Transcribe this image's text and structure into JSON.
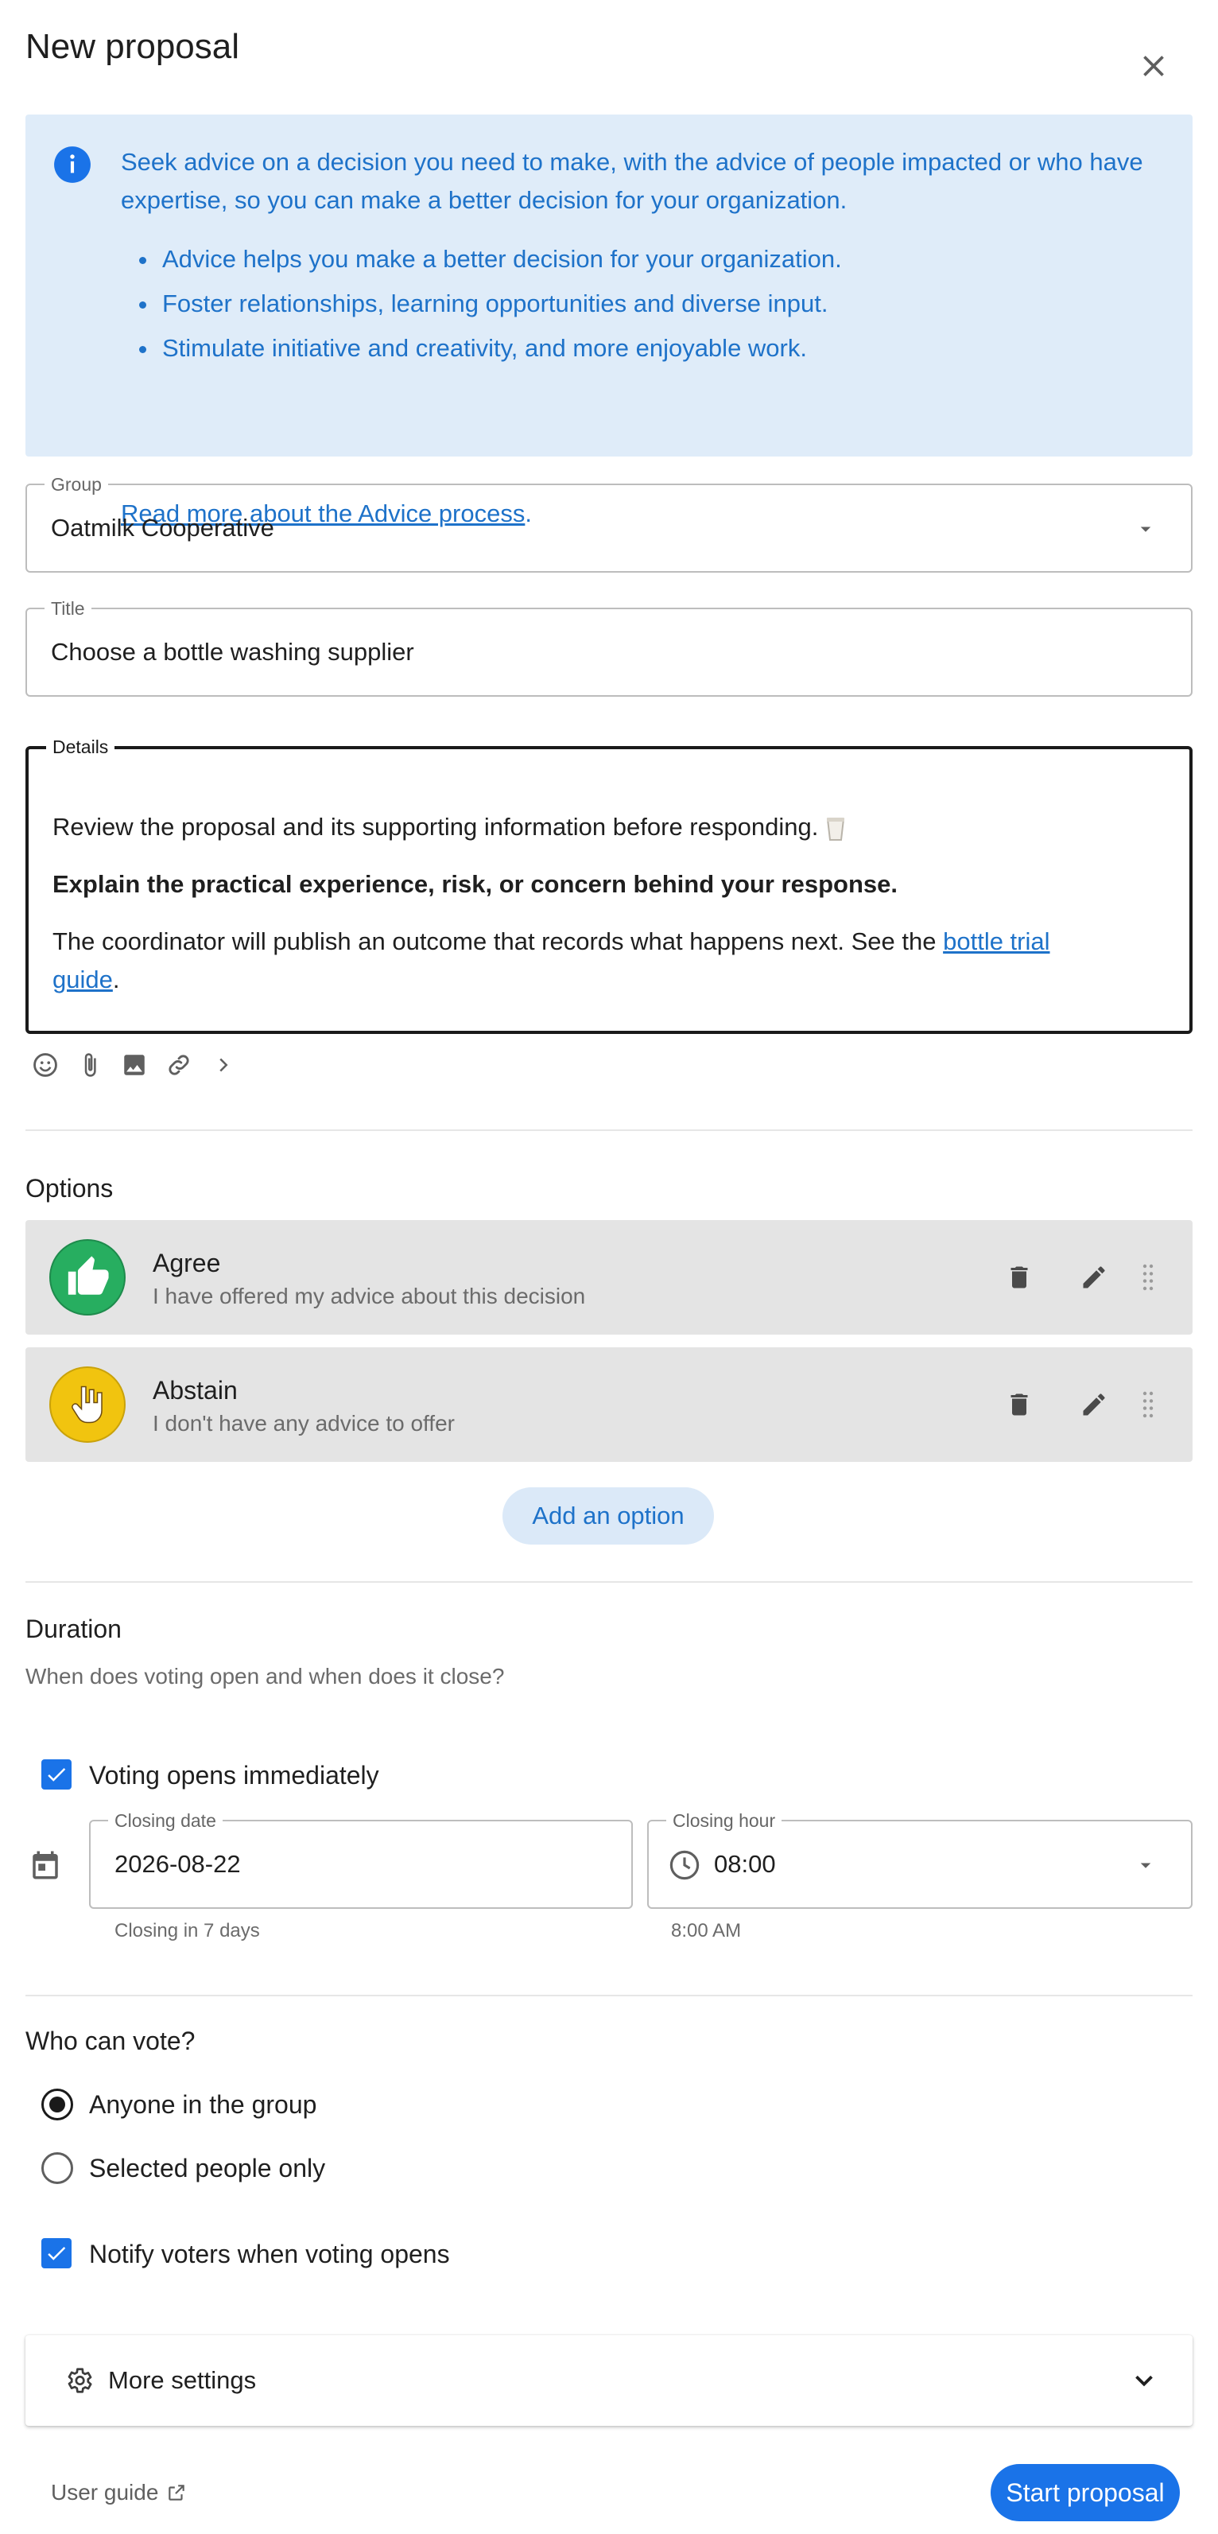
{
  "header": {
    "title": "New proposal",
    "close_icon": "close-icon"
  },
  "info_banner": {
    "icon": "info-icon",
    "intro": "Seek advice on a decision you need to make, with the advice of people impacted or who have expertise, so you can make a better decision for your organization.",
    "bullets": [
      "Advice helps you make a better decision for your organization.",
      "Foster relationships, learning opportunities and diverse input.",
      "Stimulate initiative and creativity, and more enjoyable work."
    ],
    "link_text": "Read more about the Advice process",
    "link_suffix": "."
  },
  "group": {
    "label": "Group",
    "value": "Oatmilk Cooperative"
  },
  "title_field": {
    "label": "Title",
    "value": "Choose a bottle washing supplier"
  },
  "details": {
    "label": "Details",
    "line1": "Review the proposal and its supporting information before responding.",
    "line1_icon": "cup-icon",
    "line2_bold": "Explain the practical experience, risk, or concern behind your response.",
    "line3_text": "The coordinator will publish an outcome that records what happens next. See the ",
    "line3_link_a": "bottle trial ",
    "line3_link_b": "guide",
    "line3_suffix": "."
  },
  "toolbar": {
    "icons": [
      "emoji-icon",
      "attachment-icon",
      "image-icon",
      "link-icon",
      "chevron-right-icon"
    ]
  },
  "options": {
    "title": "Options",
    "items": [
      {
        "title": "Agree",
        "description": "I have offered my advice about this decision",
        "color": "#27ae60",
        "icon": "thumbs-up-icon"
      },
      {
        "title": "Abstain",
        "description": "I don't have any advice to offer",
        "color": "#f1c40f",
        "icon": "hand-icon"
      }
    ],
    "add_label": "Add an option"
  },
  "duration": {
    "title": "Duration",
    "subtitle": "When does voting open and when does it close?",
    "opens_immediately_label": "Voting opens immediately",
    "opens_immediately_checked": true,
    "closing_date_label": "Closing date",
    "closing_date_value": "2026-08-22",
    "closing_date_helper": "Closing in 7 days",
    "closing_hour_label": "Closing hour",
    "closing_hour_value": "08:00",
    "closing_hour_helper": "8:00 AM"
  },
  "voters": {
    "title": "Who can vote?",
    "radio_options": [
      "Anyone in the group",
      "Selected people only"
    ],
    "selected": "Anyone in the group",
    "notify_label": "Notify voters when voting opens",
    "notify_checked": true
  },
  "more_settings": {
    "label": "More settings"
  },
  "footer": {
    "user_guide": "User guide",
    "start_label": "Start proposal"
  },
  "colors": {
    "accent": "#1a73e8",
    "info_bg": "#dfecf9",
    "info_text": "#1e72c9",
    "agree": "#27ae60",
    "abstain": "#f1c40f"
  }
}
